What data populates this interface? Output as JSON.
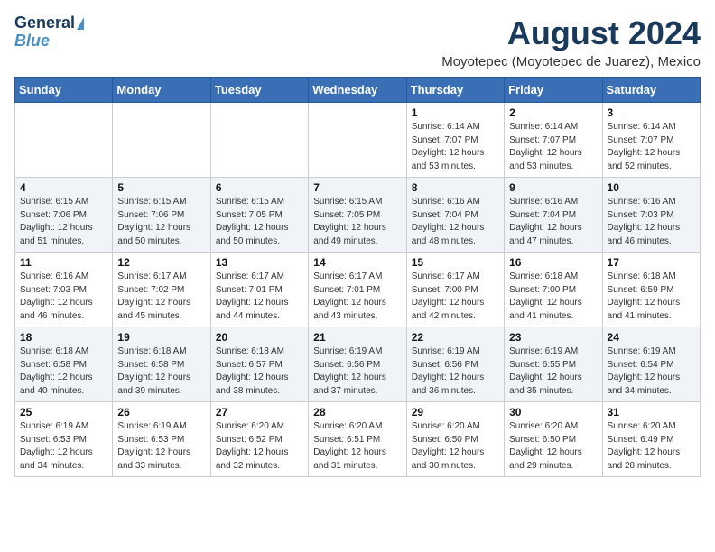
{
  "header": {
    "logo_line1": "General",
    "logo_line2": "Blue",
    "month_year": "August 2024",
    "location": "Moyotepec (Moyotepec de Juarez), Mexico"
  },
  "weekdays": [
    "Sunday",
    "Monday",
    "Tuesday",
    "Wednesday",
    "Thursday",
    "Friday",
    "Saturday"
  ],
  "weeks": [
    [
      {
        "day": "",
        "info": ""
      },
      {
        "day": "",
        "info": ""
      },
      {
        "day": "",
        "info": ""
      },
      {
        "day": "",
        "info": ""
      },
      {
        "day": "1",
        "info": "Sunrise: 6:14 AM\nSunset: 7:07 PM\nDaylight: 12 hours\nand 53 minutes."
      },
      {
        "day": "2",
        "info": "Sunrise: 6:14 AM\nSunset: 7:07 PM\nDaylight: 12 hours\nand 53 minutes."
      },
      {
        "day": "3",
        "info": "Sunrise: 6:14 AM\nSunset: 7:07 PM\nDaylight: 12 hours\nand 52 minutes."
      }
    ],
    [
      {
        "day": "4",
        "info": "Sunrise: 6:15 AM\nSunset: 7:06 PM\nDaylight: 12 hours\nand 51 minutes."
      },
      {
        "day": "5",
        "info": "Sunrise: 6:15 AM\nSunset: 7:06 PM\nDaylight: 12 hours\nand 50 minutes."
      },
      {
        "day": "6",
        "info": "Sunrise: 6:15 AM\nSunset: 7:05 PM\nDaylight: 12 hours\nand 50 minutes."
      },
      {
        "day": "7",
        "info": "Sunrise: 6:15 AM\nSunset: 7:05 PM\nDaylight: 12 hours\nand 49 minutes."
      },
      {
        "day": "8",
        "info": "Sunrise: 6:16 AM\nSunset: 7:04 PM\nDaylight: 12 hours\nand 48 minutes."
      },
      {
        "day": "9",
        "info": "Sunrise: 6:16 AM\nSunset: 7:04 PM\nDaylight: 12 hours\nand 47 minutes."
      },
      {
        "day": "10",
        "info": "Sunrise: 6:16 AM\nSunset: 7:03 PM\nDaylight: 12 hours\nand 46 minutes."
      }
    ],
    [
      {
        "day": "11",
        "info": "Sunrise: 6:16 AM\nSunset: 7:03 PM\nDaylight: 12 hours\nand 46 minutes."
      },
      {
        "day": "12",
        "info": "Sunrise: 6:17 AM\nSunset: 7:02 PM\nDaylight: 12 hours\nand 45 minutes."
      },
      {
        "day": "13",
        "info": "Sunrise: 6:17 AM\nSunset: 7:01 PM\nDaylight: 12 hours\nand 44 minutes."
      },
      {
        "day": "14",
        "info": "Sunrise: 6:17 AM\nSunset: 7:01 PM\nDaylight: 12 hours\nand 43 minutes."
      },
      {
        "day": "15",
        "info": "Sunrise: 6:17 AM\nSunset: 7:00 PM\nDaylight: 12 hours\nand 42 minutes."
      },
      {
        "day": "16",
        "info": "Sunrise: 6:18 AM\nSunset: 7:00 PM\nDaylight: 12 hours\nand 41 minutes."
      },
      {
        "day": "17",
        "info": "Sunrise: 6:18 AM\nSunset: 6:59 PM\nDaylight: 12 hours\nand 41 minutes."
      }
    ],
    [
      {
        "day": "18",
        "info": "Sunrise: 6:18 AM\nSunset: 6:58 PM\nDaylight: 12 hours\nand 40 minutes."
      },
      {
        "day": "19",
        "info": "Sunrise: 6:18 AM\nSunset: 6:58 PM\nDaylight: 12 hours\nand 39 minutes."
      },
      {
        "day": "20",
        "info": "Sunrise: 6:18 AM\nSunset: 6:57 PM\nDaylight: 12 hours\nand 38 minutes."
      },
      {
        "day": "21",
        "info": "Sunrise: 6:19 AM\nSunset: 6:56 PM\nDaylight: 12 hours\nand 37 minutes."
      },
      {
        "day": "22",
        "info": "Sunrise: 6:19 AM\nSunset: 6:56 PM\nDaylight: 12 hours\nand 36 minutes."
      },
      {
        "day": "23",
        "info": "Sunrise: 6:19 AM\nSunset: 6:55 PM\nDaylight: 12 hours\nand 35 minutes."
      },
      {
        "day": "24",
        "info": "Sunrise: 6:19 AM\nSunset: 6:54 PM\nDaylight: 12 hours\nand 34 minutes."
      }
    ],
    [
      {
        "day": "25",
        "info": "Sunrise: 6:19 AM\nSunset: 6:53 PM\nDaylight: 12 hours\nand 34 minutes."
      },
      {
        "day": "26",
        "info": "Sunrise: 6:19 AM\nSunset: 6:53 PM\nDaylight: 12 hours\nand 33 minutes."
      },
      {
        "day": "27",
        "info": "Sunrise: 6:20 AM\nSunset: 6:52 PM\nDaylight: 12 hours\nand 32 minutes."
      },
      {
        "day": "28",
        "info": "Sunrise: 6:20 AM\nSunset: 6:51 PM\nDaylight: 12 hours\nand 31 minutes."
      },
      {
        "day": "29",
        "info": "Sunrise: 6:20 AM\nSunset: 6:50 PM\nDaylight: 12 hours\nand 30 minutes."
      },
      {
        "day": "30",
        "info": "Sunrise: 6:20 AM\nSunset: 6:50 PM\nDaylight: 12 hours\nand 29 minutes."
      },
      {
        "day": "31",
        "info": "Sunrise: 6:20 AM\nSunset: 6:49 PM\nDaylight: 12 hours\nand 28 minutes."
      }
    ]
  ]
}
